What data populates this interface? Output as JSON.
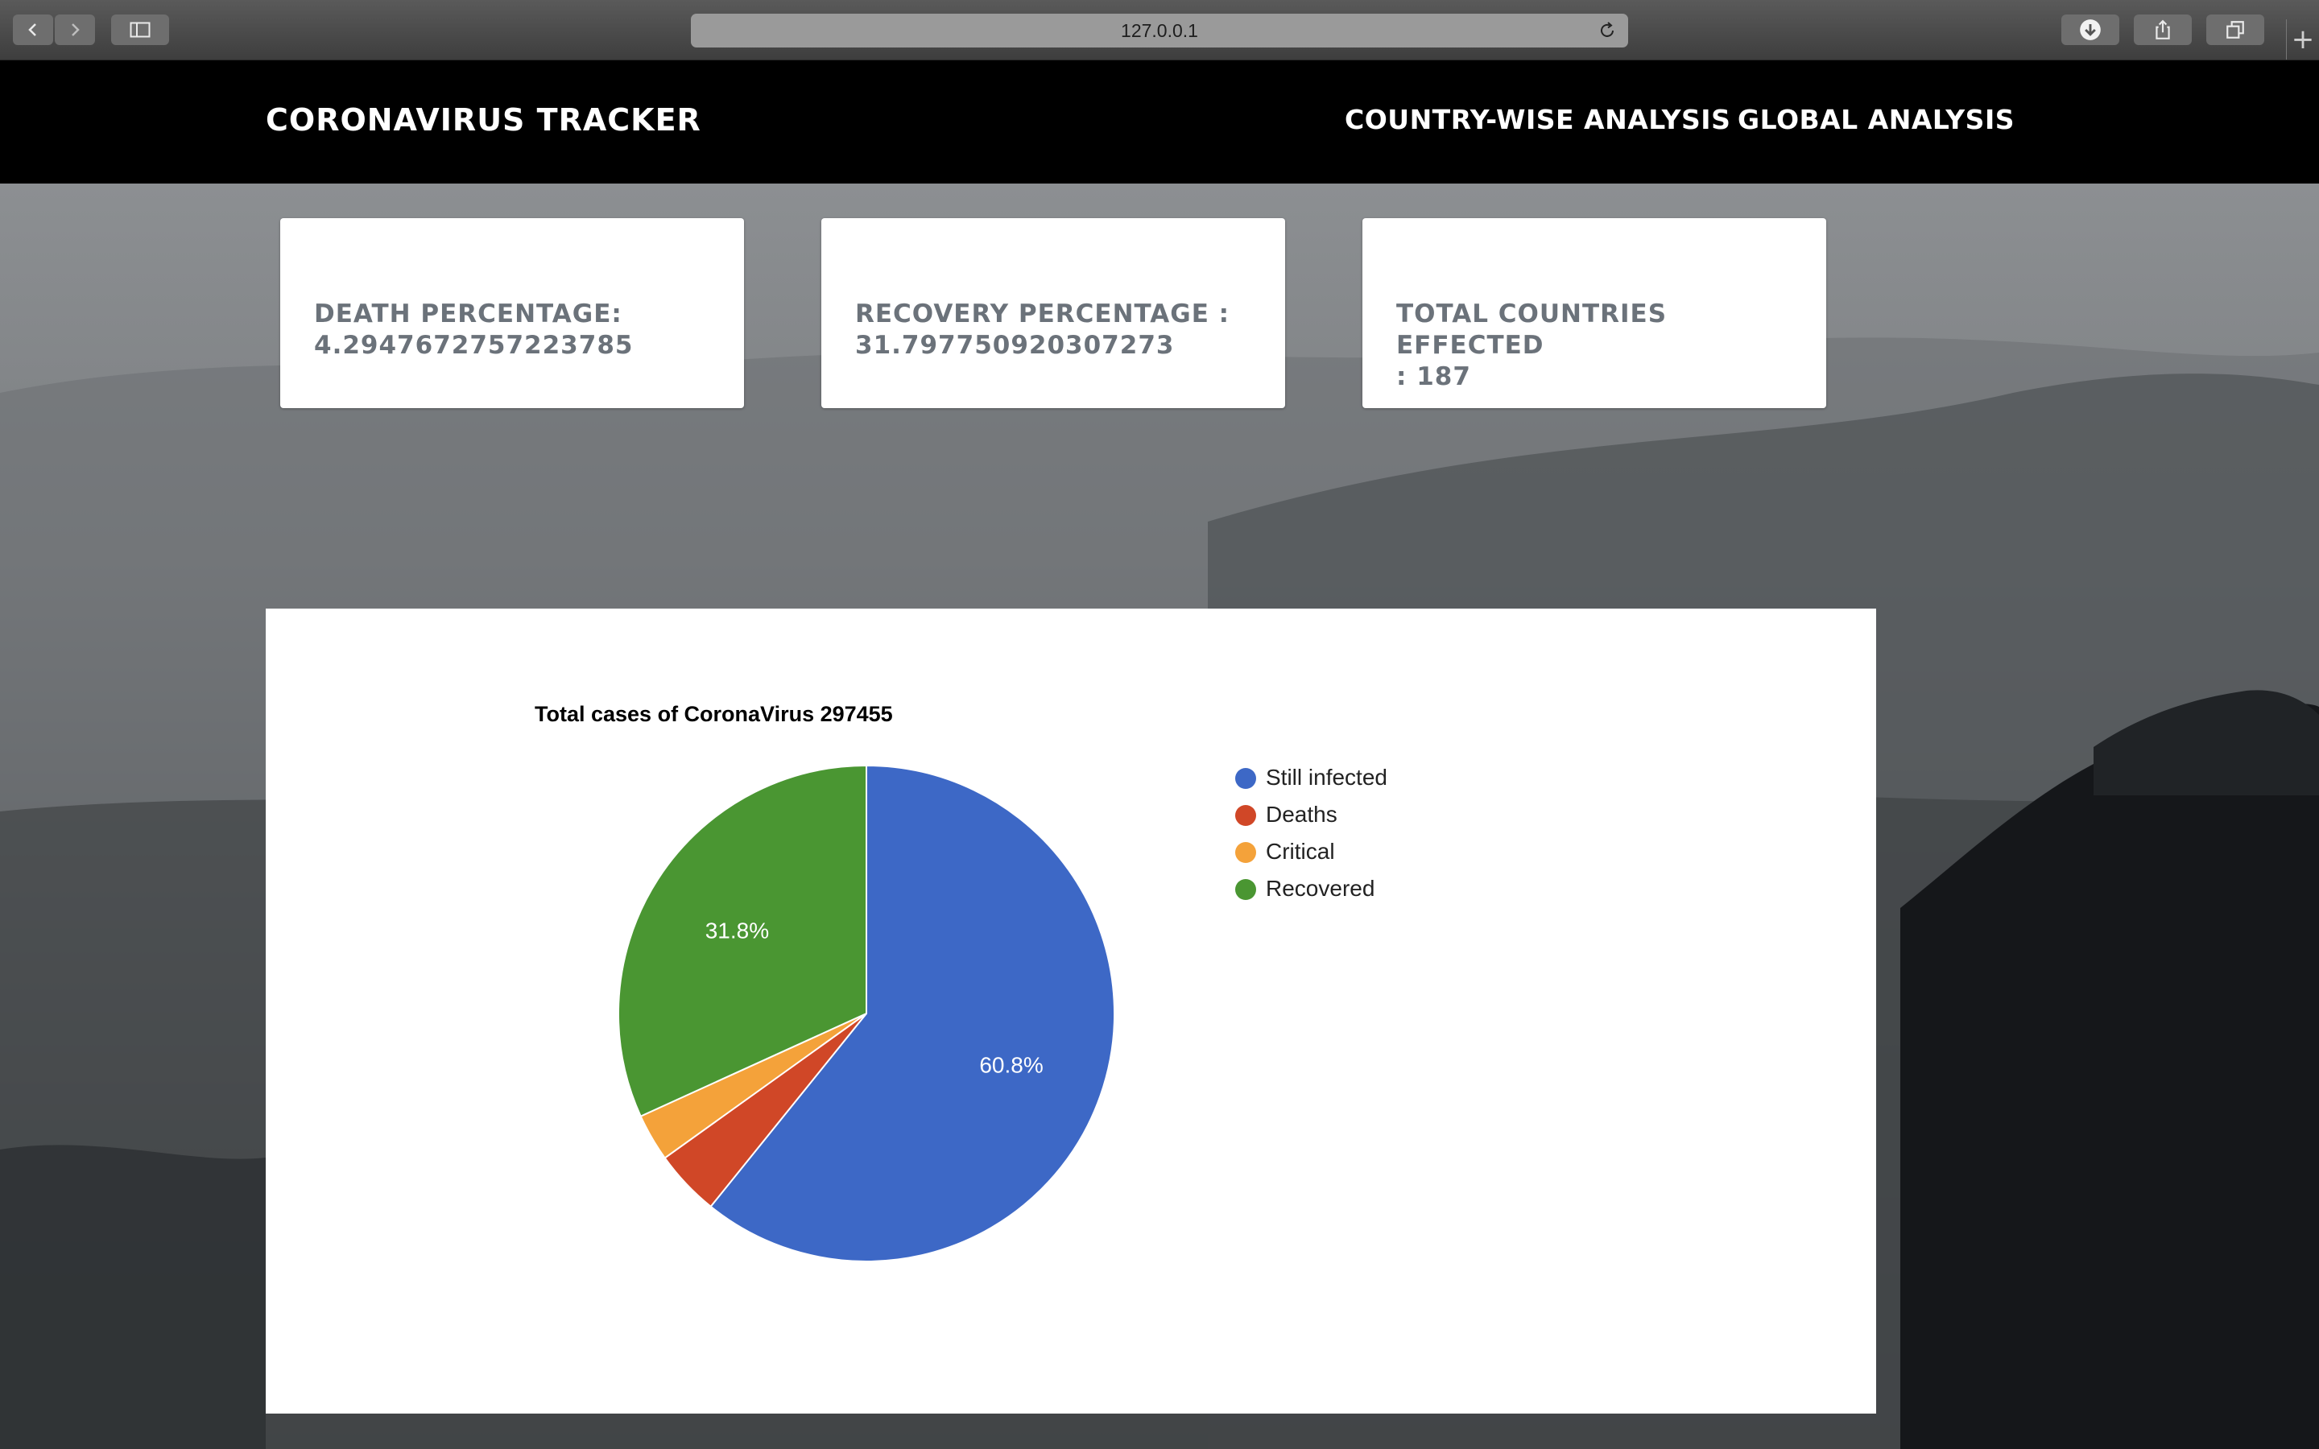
{
  "browser": {
    "url": "127.0.0.1",
    "new_tab_label": "+"
  },
  "navbar": {
    "brand": "CORONAVIRUS TRACKER",
    "links": [
      "COUNTRY-WISE ANALYSIS",
      "GLOBAL ANALYSIS"
    ]
  },
  "stats": [
    {
      "line1": "DEATH PERCENTAGE:",
      "line2": "4.2947672757223785"
    },
    {
      "line1": "RECOVERY PERCENTAGE :",
      "line2": "31.797750920307273"
    },
    {
      "line1": "TOTAL COUNTRIES EFFECTED",
      "line2": ": 187"
    }
  ],
  "chart_data": {
    "type": "pie",
    "title": "Total cases of CoronaVirus 297455",
    "legend_position": "right",
    "slices": [
      {
        "label": "Still infected",
        "value": 60.8,
        "color": "#3d68c6",
        "data_label": "60.8%"
      },
      {
        "label": "Deaths",
        "value": 4.3,
        "color": "#d04727",
        "data_label": ""
      },
      {
        "label": "Critical",
        "value": 3.1,
        "color": "#f4a23a",
        "data_label": ""
      },
      {
        "label": "Recovered",
        "value": 31.8,
        "color": "#4a9632",
        "data_label": "31.8%"
      }
    ]
  }
}
